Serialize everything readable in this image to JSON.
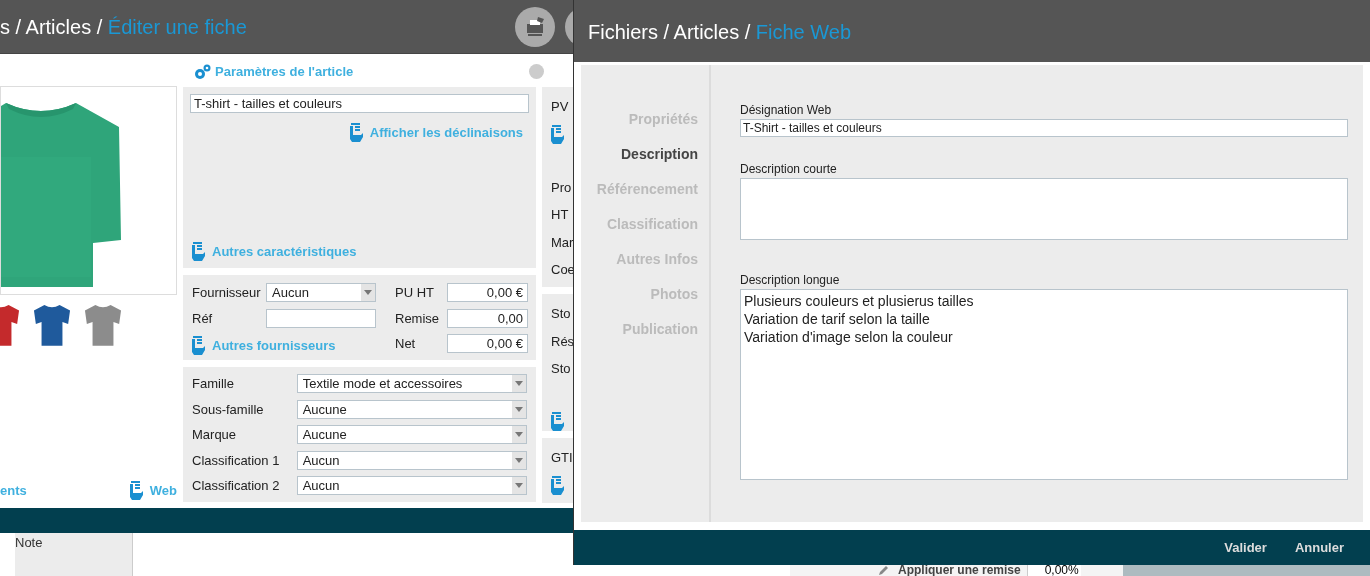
{
  "article_window": {
    "path": "s / Articles /",
    "current": "Éditer une fiche",
    "image_panel": {
      "thumbnails": [
        {
          "color": "#c42a2c"
        },
        {
          "color": "#1f5a9c"
        },
        {
          "color": "#8c8c8c"
        }
      ],
      "links": [
        "ents",
        "Web"
      ]
    },
    "parameters": {
      "title": "Paramètres de l'article",
      "name": "T-shirt - tailles et couleurs",
      "links": [
        "Afficher les déclinaisons",
        "Autres caractéristiques"
      ]
    },
    "supplier": {
      "supplier_label": "Fournisseur",
      "supplier_value": "Aucun",
      "ref_label": "Réf",
      "link": "Autres fournisseurs",
      "prices": [
        {
          "label": "PU HT",
          "value": "0,00 €"
        },
        {
          "label": "Remise",
          "value": "0,00"
        },
        {
          "label": "Net",
          "value": "0,00 €"
        }
      ]
    },
    "classification": [
      {
        "label": "Famille",
        "value": "Textile mode et accessoires"
      },
      {
        "label": "Sous-famille",
        "value": "Aucune"
      },
      {
        "label": "Marque",
        "value": "Aucune"
      },
      {
        "label": "Classification 1",
        "value": "Aucun"
      },
      {
        "label": "Classification 2",
        "value": "Aucun"
      }
    ],
    "right_column": [
      {
        "labels": [
          "PV"
        ],
        "link": true,
        "labels_after": [
          "Pro",
          "HT",
          "Mar",
          "Coe"
        ]
      },
      {
        "labels": [
          "Sto",
          "Rés",
          "Sto"
        ],
        "link": true
      },
      {
        "labels": [
          "GTI"
        ],
        "link": true
      }
    ],
    "note_tab": "Note"
  },
  "web_dialog": {
    "path": "Fichiers / Articles /",
    "current": "Fiche Web",
    "nav": [
      {
        "label": "Propriétés",
        "selected": false
      },
      {
        "label": "Description",
        "selected": true
      },
      {
        "label": "Référencement",
        "selected": false
      },
      {
        "label": "Classification",
        "selected": false
      },
      {
        "label": "Autres Infos",
        "selected": false
      },
      {
        "label": "Photos",
        "selected": false
      },
      {
        "label": "Publication",
        "selected": false
      }
    ],
    "fields": [
      {
        "kind": "input",
        "label": "Désignation Web",
        "value": "T-Shirt - tailles et couleurs"
      },
      {
        "kind": "short_text",
        "label": "Description courte"
      },
      {
        "kind": "long_text",
        "label": "Description longue",
        "value": "Plusieurs couleurs et plusierus tailles\nVariation de tarif selon la taille\nVariation d'image selon la couleur"
      }
    ],
    "buttons": [
      "Valider",
      "Annuler"
    ]
  },
  "behind_strip": {
    "label": "Appliquer une remise",
    "value": "0,00%"
  }
}
